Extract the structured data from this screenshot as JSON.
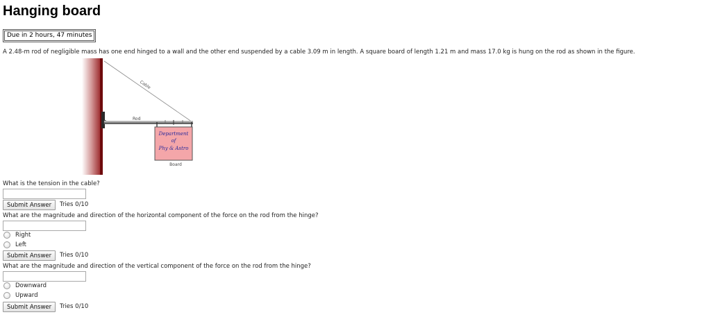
{
  "title": "Hanging board",
  "due": "Due in 2 hours, 47 minutes",
  "intro": "A 2.48-m rod of negligible mass has one end hinged to a wall and the other end suspended by a cable 3.09 m in length. A square board of length 1.21 m and mass 17.0 kg is hung on the rod as shown in the figure.",
  "figure": {
    "cable_label": "Cable",
    "rod_label": "Rod",
    "board_lines": [
      "Department",
      "of",
      "Phy & Astro"
    ],
    "board_label": "Board"
  },
  "questions": [
    {
      "text": "What is the tension in the cable?",
      "input_value": "",
      "options": [],
      "submit_label": "Submit Answer",
      "tries": "Tries 0/10"
    },
    {
      "text": "What are the magnitude and direction of the horizontal component of the force on the rod from the hinge?",
      "input_value": "",
      "options": [
        "Right",
        "Left"
      ],
      "submit_label": "Submit Answer",
      "tries": "Tries 0/10"
    },
    {
      "text": "What are the magnitude and direction of the vertical component of the force on the rod from the hinge?",
      "input_value": "",
      "options": [
        "Downward",
        "Upward"
      ],
      "submit_label": "Submit Answer",
      "tries": "Tries 0/10"
    }
  ]
}
